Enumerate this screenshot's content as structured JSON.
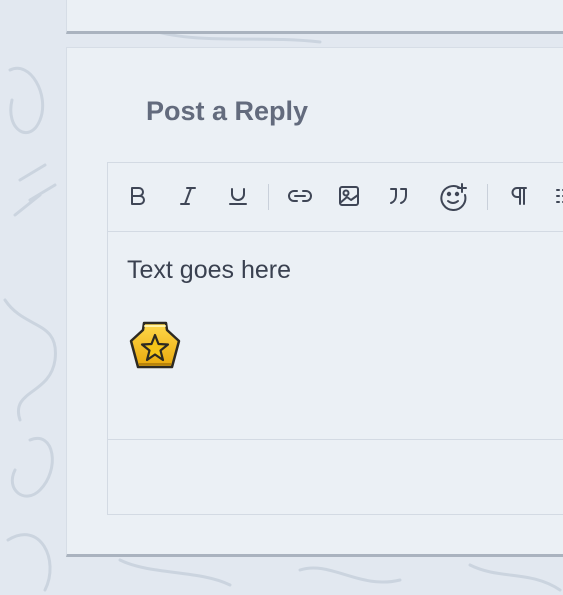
{
  "reply": {
    "title": "Post a Reply",
    "content_text": "Text goes here",
    "inserted_image": "star-badge-icon"
  },
  "toolbar": {
    "buttons": [
      {
        "name": "bold-button",
        "icon": "bold-icon"
      },
      {
        "name": "italic-button",
        "icon": "italic-icon"
      },
      {
        "name": "underline-button",
        "icon": "underline-icon"
      },
      {
        "name": "link-button",
        "icon": "link-icon"
      },
      {
        "name": "image-button",
        "icon": "image-icon"
      },
      {
        "name": "quote-button",
        "icon": "quote-icon"
      },
      {
        "name": "emoji-button",
        "icon": "emoji-add-icon"
      },
      {
        "name": "paragraph-button",
        "icon": "pilcrow-icon"
      },
      {
        "name": "list-button",
        "icon": "list-icon"
      }
    ]
  },
  "colors": {
    "page_background": "#e2e8f0",
    "panel_background": "#ebf0f5",
    "title_text": "#636b7d",
    "body_text": "#3a4150",
    "icon_stroke": "#3f4656",
    "badge_gold": "#f5c518"
  }
}
